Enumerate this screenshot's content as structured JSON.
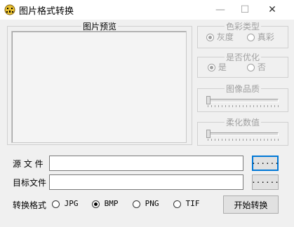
{
  "window": {
    "title": "图片格式转换",
    "minimize_label": "—",
    "maximize_label": "☐",
    "close_label": "✕"
  },
  "preview": {
    "legend": "图片预览"
  },
  "color_type": {
    "legend": "色彩类型",
    "options": [
      {
        "label": "灰度",
        "checked": true
      },
      {
        "label": "真彩",
        "checked": false
      }
    ]
  },
  "optimize": {
    "legend": "是否优化",
    "options": [
      {
        "label": "是",
        "checked": true
      },
      {
        "label": "否",
        "checked": false
      }
    ]
  },
  "quality": {
    "legend": "图像品质",
    "value": 0
  },
  "smoothing": {
    "legend": "柔化数值",
    "value": 0
  },
  "source": {
    "label": "源 文 件",
    "value": "",
    "browse_label": "······"
  },
  "target": {
    "label": "目标文件",
    "value": "",
    "browse_label": "······"
  },
  "format": {
    "label": "转换格式",
    "options": [
      {
        "label": "JPG",
        "checked": false
      },
      {
        "label": "BMP",
        "checked": true
      },
      {
        "label": "PNG",
        "checked": false
      },
      {
        "label": "TIF",
        "checked": false
      }
    ]
  },
  "start_button": "开始转换"
}
